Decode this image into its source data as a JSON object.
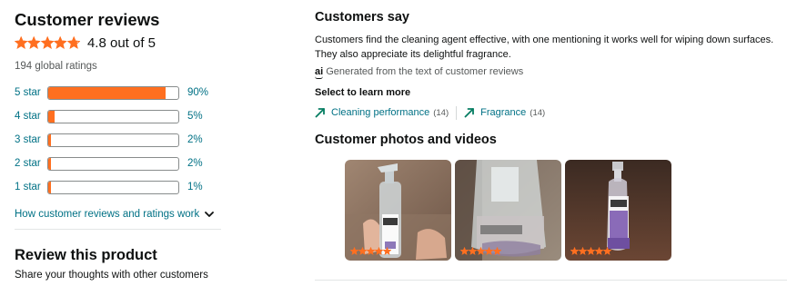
{
  "reviews": {
    "title": "Customer reviews",
    "rating_value": 4.8,
    "rating_text": "4.8 out of 5",
    "star_icon": "star-icon",
    "star_color": "#ff6f20",
    "global_ratings": "194 global ratings",
    "histogram": [
      {
        "label": "5 star",
        "pct": "90%",
        "value": 90
      },
      {
        "label": "4 star",
        "pct": "5%",
        "value": 5
      },
      {
        "label": "3 star",
        "pct": "2%",
        "value": 2
      },
      {
        "label": "2 star",
        "pct": "2%",
        "value": 2
      },
      {
        "label": "1 star",
        "pct": "1%",
        "value": 1
      }
    ],
    "how_link": "How customer reviews and ratings work",
    "link_color": "#007185"
  },
  "review_product": {
    "title": "Review this product",
    "subtitle": "Share your thoughts with other customers"
  },
  "customers_say": {
    "title": "Customers say",
    "text": "Customers find the cleaning agent effective, with one mentioning it works well for wiping down surfaces. They also appreciate its delightful fragrance.",
    "ai_badge": "ai",
    "ai_note": "Generated from the text of customer reviews",
    "select_label": "Select to learn more",
    "aspects": [
      {
        "label": "Cleaning performance",
        "count": "(14)",
        "icon": "trend-up-arrow-icon"
      },
      {
        "label": "Fragrance",
        "count": "(14)",
        "icon": "trend-up-arrow-icon"
      }
    ]
  },
  "media": {
    "title": "Customer photos and videos",
    "photos": [
      {
        "stars": 5,
        "description_icon": "photo-thumbnail"
      },
      {
        "stars": 5,
        "description_icon": "photo-thumbnail"
      },
      {
        "stars": 5,
        "description_icon": "photo-thumbnail"
      }
    ]
  }
}
